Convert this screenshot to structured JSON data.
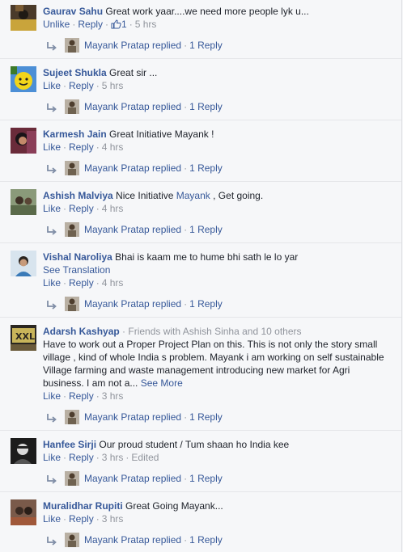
{
  "comments": [
    {
      "author": "Gaurav Sahu",
      "text": "Great work yaar....we need more people lyk u...",
      "actions": {
        "like": "Unlike",
        "reply": "Reply",
        "likes": "1",
        "time": "5 hrs"
      },
      "reply": {
        "name": "Mayank Pratap replied",
        "count": "1 Reply"
      }
    },
    {
      "author": "Sujeet Shukla",
      "text": "Great sir ...",
      "actions": {
        "like": "Like",
        "reply": "Reply",
        "time": "5 hrs"
      },
      "reply": {
        "name": "Mayank Pratap replied",
        "count": "1 Reply"
      }
    },
    {
      "author": "Karmesh Jain",
      "text": "Great Initiative Mayank !",
      "actions": {
        "like": "Like",
        "reply": "Reply",
        "time": "4 hrs"
      },
      "reply": {
        "name": "Mayank Pratap replied",
        "count": "1 Reply"
      }
    },
    {
      "author": "Ashish Malviya",
      "text_before": "Nice Initiative",
      "mention": "Mayank",
      "text_after": ", Get going.",
      "actions": {
        "like": "Like",
        "reply": "Reply",
        "time": "4 hrs"
      },
      "reply": {
        "name": "Mayank Pratap replied",
        "count": "1 Reply"
      }
    },
    {
      "author": "Vishal Naroliya",
      "text": "Bhai is kaam me to hume bhi sath le lo yar",
      "see_translation": "See Translation",
      "actions": {
        "like": "Like",
        "reply": "Reply",
        "time": "4 hrs"
      },
      "reply": {
        "name": "Mayank Pratap replied",
        "count": "1 Reply"
      }
    },
    {
      "author": "Adarsh Kashyap",
      "friends": "· Friends with Ashish Sinha and 10 others",
      "text": "Have to work out a Proper Project Plan on this. This is not only the story small village , kind of whole India s problem. Mayank i am working on self sustainable Village farming and waste management introducing new market for Agri business. I am not a...",
      "see_more": "See More",
      "actions": {
        "like": "Like",
        "reply": "Reply",
        "time": "3 hrs"
      },
      "reply": {
        "name": "Mayank Pratap replied",
        "count": "1 Reply"
      }
    },
    {
      "author": "Hanfee Sirji",
      "text": "Our proud student / Tum shaan ho India kee",
      "actions": {
        "like": "Like",
        "reply": "Reply",
        "time": "3 hrs",
        "edited": "Edited"
      },
      "reply": {
        "name": "Mayank Pratap replied",
        "count": "1 Reply"
      }
    },
    {
      "author": "Muralidhar Rupiti",
      "text": "Great Going Mayank...",
      "actions": {
        "like": "Like",
        "reply": "Reply",
        "time": "3 hrs"
      },
      "reply": {
        "name": "Mayank Pratap replied",
        "count": "1 Reply"
      }
    }
  ],
  "colors": {
    "link": "#365899",
    "meta": "#90949c",
    "text": "#1d2129",
    "background": "#f6f7f9"
  },
  "icons": {
    "reply_arrow": "reply-arrow-icon",
    "like_thumb": "thumbs-up-icon"
  }
}
